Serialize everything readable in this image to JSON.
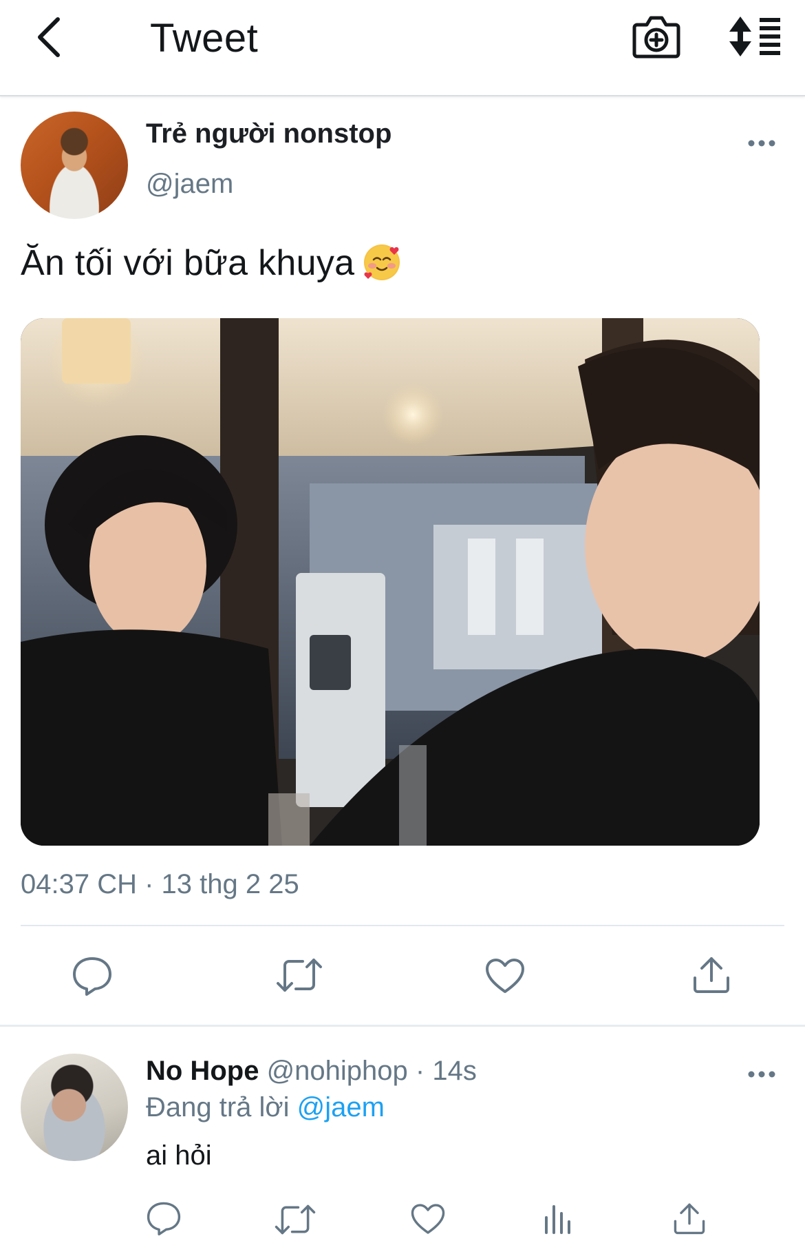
{
  "header": {
    "title": "Tweet",
    "back_icon": "chevron-left-icon",
    "camera_icon": "camera-plus-icon",
    "sort_icon": "sort-list-icon"
  },
  "tweet": {
    "author_name": "Trẻ người nonstop",
    "author_handle": "@jaem",
    "text": "Ăn tối với bữa khuya",
    "emoji_icon": "smiling-face-with-hearts-icon",
    "timestamp": "04:37 CH · 13 thg 2 25",
    "actions": [
      "reply-icon",
      "retweet-icon",
      "like-icon",
      "share-icon"
    ]
  },
  "reply": {
    "author_name": "No Hope",
    "author_handle": "@nohiphop",
    "separator": "·",
    "time": "14s",
    "replying_label": "Đang trả lời",
    "replying_to": "@jaem",
    "text": "ai hỏi",
    "actions": [
      "reply-icon",
      "retweet-icon",
      "like-icon",
      "analytics-icon",
      "share-icon"
    ]
  },
  "colors": {
    "text_primary": "#14171a",
    "text_secondary": "#657786",
    "link": "#1da1f2",
    "divider": "#e1e8ed"
  }
}
